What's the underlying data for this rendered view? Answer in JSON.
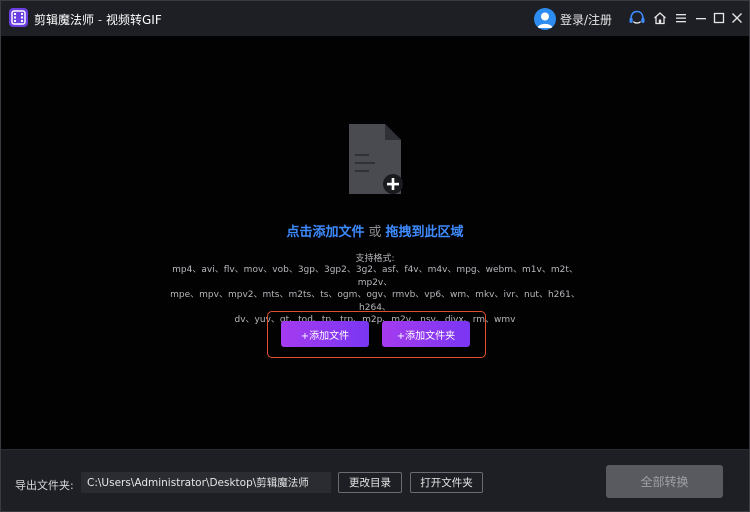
{
  "titlebar": {
    "app_name": "剪辑魔法师",
    "separator": " - ",
    "page_title": "视频转GIF",
    "login_label": "登录/注册"
  },
  "drop_zone": {
    "click_add": "点击添加文件",
    "or": "或",
    "drag_here": "拖拽到此区域",
    "formats_label": "支持格式:",
    "formats_line1": "mp4、avi、flv、mov、vob、3gp、3gp2、3g2、asf、f4v、m4v、mpg、webm、m1v、m2t、mp2v、",
    "formats_line2": "mpe、mpv、mpv2、mts、m2ts、ts、ogm、ogv、rmvb、vp6、wm、mkv、ivr、nut、h261、h264、",
    "formats_line3": "dv、yuv、qt、tod、tp、trp、m2p、m2v、nsv、divx、rm、wmv",
    "add_file_label": "+添加文件",
    "add_folder_label": "+添加文件夹"
  },
  "bottom_bar": {
    "output_label": "导出文件夹:",
    "output_path": "C:\\Users\\Administrator\\Desktop\\剪辑魔法师",
    "change_dir_label": "更改目录",
    "open_folder_label": "打开文件夹",
    "convert_all_label": "全部转换"
  },
  "colors": {
    "accent_blue": "#3e8bff",
    "button_purple_start": "#a43bf0",
    "button_purple_end": "#7a36f2",
    "highlight_border": "#e0502c"
  }
}
